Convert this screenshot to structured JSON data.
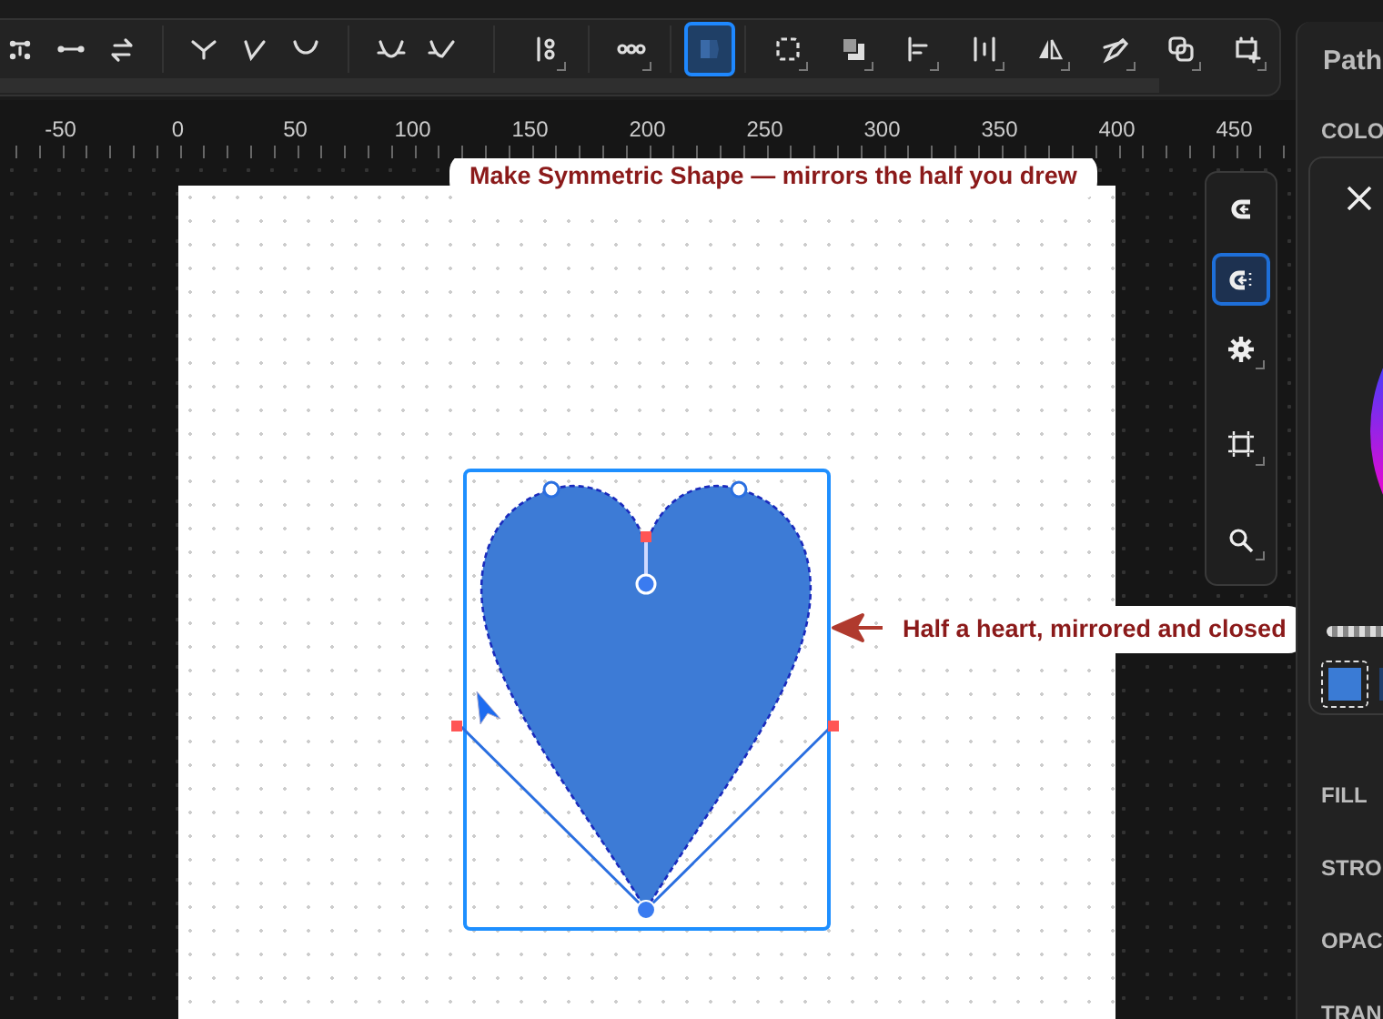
{
  "toolbar": {
    "groups": [
      [
        {
          "selected": false,
          "flyout": false
        },
        {
          "selected": false,
          "flyout": false
        },
        {
          "selected": false,
          "flyout": false
        }
      ],
      [
        {
          "selected": false,
          "flyout": false
        },
        {
          "selected": false,
          "flyout": false
        },
        {
          "selected": false,
          "flyout": false
        }
      ],
      [
        {
          "selected": false,
          "flyout": false
        },
        {
          "selected": false,
          "flyout": false
        }
      ],
      [
        {
          "selected": false,
          "flyout": true
        }
      ],
      [
        {
          "selected": false,
          "flyout": true
        }
      ],
      [
        {
          "selected": true,
          "flyout": false
        }
      ],
      [
        {
          "selected": false,
          "flyout": true
        },
        {
          "selected": false,
          "flyout": true
        },
        {
          "selected": false,
          "flyout": true
        },
        {
          "selected": false,
          "flyout": true
        },
        {
          "selected": false,
          "flyout": true
        },
        {
          "selected": false,
          "flyout": true
        },
        {
          "selected": false,
          "flyout": true
        },
        {
          "selected": false,
          "flyout": true
        }
      ]
    ]
  },
  "ruler": {
    "labels": [
      "-50",
      "0",
      "50",
      "100",
      "150",
      "200",
      "250",
      "300",
      "350",
      "400",
      "450"
    ]
  },
  "canvas": {
    "callouts": [
      {
        "text": "Make Symmetric Shape — mirrors the half you drew",
        "kind": "up"
      },
      {
        "text": "Half a heart, mirrored and closed",
        "kind": "left"
      }
    ]
  },
  "tool_palette": [
    {
      "selected": false,
      "flyout": false
    },
    {
      "selected": true,
      "flyout": false
    },
    {
      "selected": false,
      "flyout": true
    },
    {
      "selected": false,
      "flyout": true
    },
    {
      "selected": false,
      "flyout": true
    }
  ],
  "panel": {
    "title": "Path",
    "section": "COLO",
    "color_picker": {
      "swatches": [
        {
          "color": "#3a7bd5",
          "selected": true
        },
        {
          "color": "#1f3f6e",
          "selected": false
        }
      ]
    },
    "properties": [
      "FILL",
      "STRO",
      "OPAC",
      "TRAN"
    ]
  }
}
